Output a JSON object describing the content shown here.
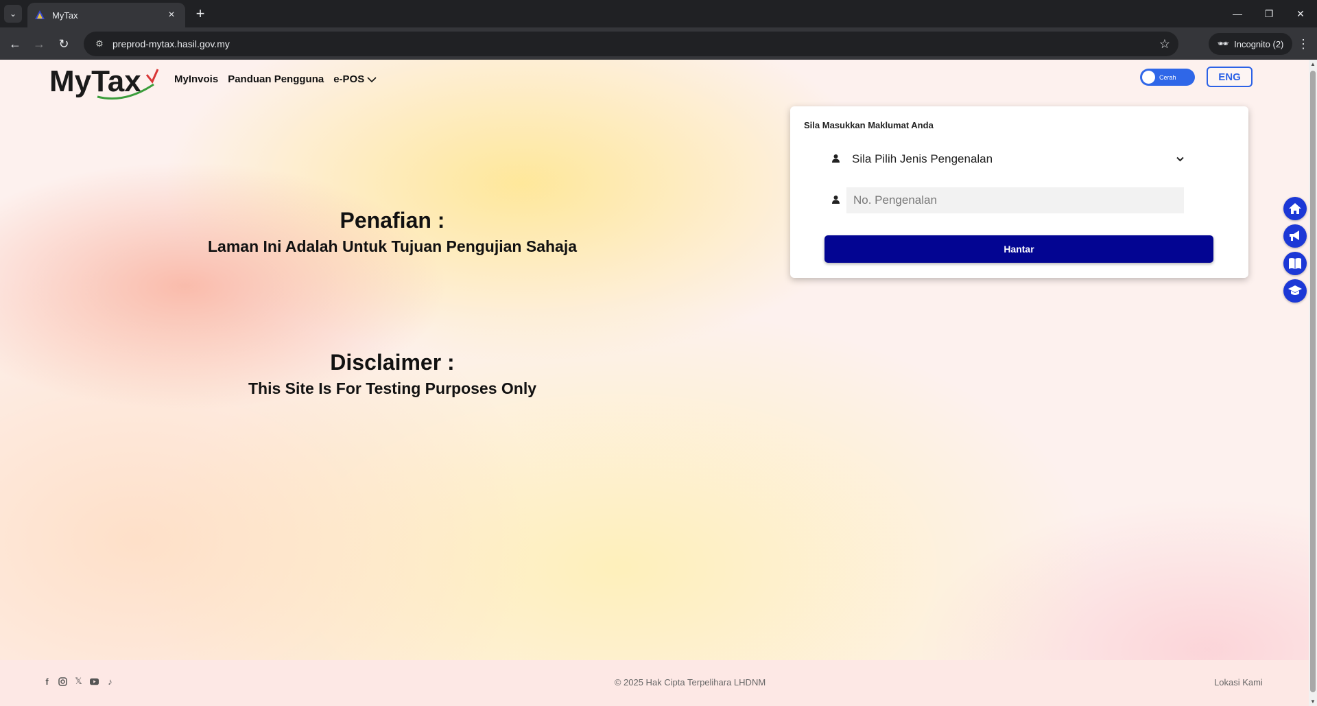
{
  "browser": {
    "tab_title": "MyTax",
    "url": "preprod-mytax.hasil.gov.my",
    "incognito_label": "Incognito (2)"
  },
  "header": {
    "logo_text": "MyTax",
    "nav": [
      {
        "label": "MyInvois"
      },
      {
        "label": "Panduan Pengguna"
      },
      {
        "label": "e-POS"
      }
    ],
    "theme_toggle_label": "Cerah",
    "language_button": "ENG"
  },
  "disclaimer": {
    "malay_title": "Penafian :",
    "malay_text": "Laman Ini Adalah Untuk Tujuan Pengujian Sahaja",
    "english_title": "Disclaimer :",
    "english_text": "This Site Is For Testing Purposes Only"
  },
  "login_card": {
    "title": "Sila Masukkan Maklumat Anda",
    "id_type_selected": "Sila Pilih Jenis Pengenalan",
    "id_number_placeholder": "No. Pengenalan",
    "submit_label": "Hantar"
  },
  "side_buttons": [
    "home-icon",
    "megaphone-icon",
    "book-icon",
    "graduation-cap-icon"
  ],
  "footer": {
    "social_icons": [
      "facebook-icon",
      "instagram-icon",
      "x-icon",
      "youtube-icon",
      "tiktok-icon"
    ],
    "copyright": "© 2025 Hak Cipta Terpelihara LHDNM",
    "location_link": "Lokasi Kami"
  },
  "colors": {
    "primary_button": "#030592",
    "accent_blue": "#2c62e6",
    "side_button": "#1c38d6"
  }
}
